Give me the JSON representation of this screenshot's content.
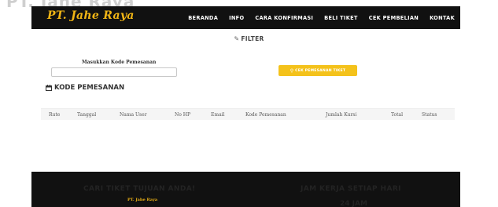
{
  "header": {
    "ghost_text": "PT. Jahe Raya",
    "brand": "PT. Jahe Raya",
    "nav": [
      "BERANDA",
      "INFO",
      "CARA KONFIRMASI",
      "BELI TIKET",
      "CEK PEMBELIAN",
      "KONTAK"
    ]
  },
  "filter": {
    "title": "FILTER",
    "icon": "edit-icon",
    "input_label": "Masukkan Kode Pemesanan",
    "input_value": "",
    "input_placeholder": "",
    "button_label": "CEK PEMESANAN TIKET",
    "button_icon": "search-icon",
    "accent_color": "#f4c21b"
  },
  "kode_pemesanan": {
    "title": "KODE PEMESANAN",
    "icon": "calendar-icon",
    "columns": [
      "Rute",
      "Tanggal",
      "Nama User",
      "No HP",
      "Email",
      "Kode Pemesanan",
      "Jumlah Kursi",
      "Total",
      "Status"
    ]
  },
  "footer": {
    "left_title": "CARI TIKET TUJUAN ANDA!",
    "left_subtitle": "PT. Jahe Raya",
    "right_title": "JAM KERJA SETIAP HARI",
    "right_subtitle": "24 JAM"
  }
}
